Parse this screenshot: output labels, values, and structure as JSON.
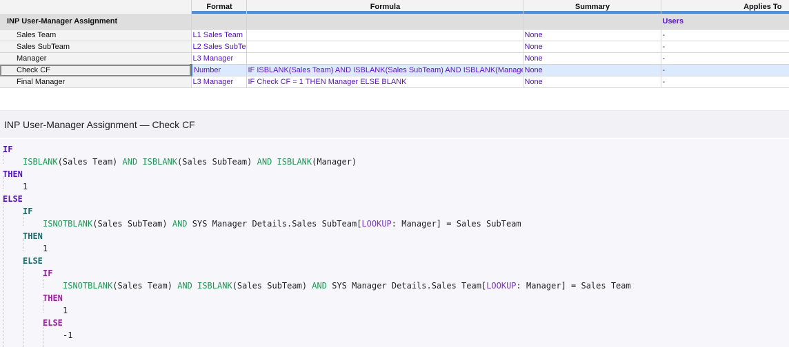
{
  "grid": {
    "headers": {
      "format": "Format",
      "formula": "Formula",
      "summary": "Summary",
      "applies_to": "Applies To"
    },
    "group": {
      "name": "INP User-Manager Assignment",
      "applies_to": "Users"
    },
    "rows": [
      {
        "name": "Sales Team",
        "format": "L1 Sales Team",
        "formula": "",
        "summary": "None",
        "applies_to": "-"
      },
      {
        "name": "Sales SubTeam",
        "format": "L2 Sales SubTe",
        "formula": "",
        "summary": "None",
        "applies_to": "-"
      },
      {
        "name": "Manager",
        "format": "L3 Manager",
        "formula": "",
        "summary": "None",
        "applies_to": "-"
      },
      {
        "name": "Check CF",
        "format": "Number",
        "formula": "IF ISBLANK(Sales Team) AND ISBLANK(Sales SubTeam) AND ISBLANK(Manage",
        "summary": "None",
        "applies_to": "-"
      },
      {
        "name": "Final Manager",
        "format": "L3 Manager",
        "formula": "IF Check CF = 1 THEN Manager ELSE BLANK",
        "summary": "None",
        "applies_to": "-"
      }
    ]
  },
  "detail": {
    "title": "INP User-Manager Assignment — Check CF",
    "tokens": {
      "if": "IF",
      "then": "THEN",
      "else": "ELSE",
      "and": "AND",
      "isblank": "ISBLANK",
      "isnotblank": "ISNOTBLANK",
      "lookup": "LOOKUP",
      "one": "1",
      "minus_one": "-1",
      "sales_team": "(Sales Team)",
      "sales_subteam": "(Sales SubTeam)",
      "manager": "(Manager)",
      "sys_subteam": "SYS Manager Details.Sales SubTeam[",
      "sys_team": "SYS Manager Details.Sales Team[",
      "lookup_tail_subteam": ": Manager] = Sales SubTeam",
      "lookup_tail_team": ": Manager] = Sales Team"
    }
  }
}
